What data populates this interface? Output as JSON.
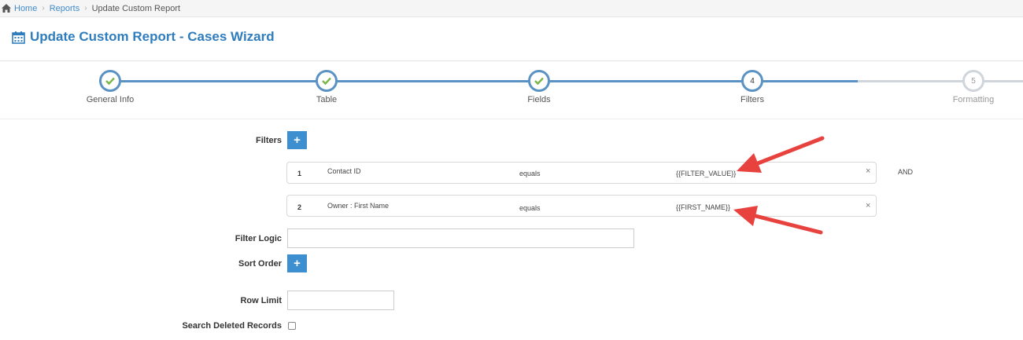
{
  "breadcrumb": {
    "home": "Home",
    "reports": "Reports",
    "current": "Update Custom Report"
  },
  "page": {
    "title": "Update Custom Report - Cases Wizard"
  },
  "wizard": {
    "steps": [
      {
        "label": "General Info",
        "state": "complete",
        "number": ""
      },
      {
        "label": "Table",
        "state": "complete",
        "number": ""
      },
      {
        "label": "Fields",
        "state": "complete",
        "number": ""
      },
      {
        "label": "Filters",
        "state": "active",
        "number": "4"
      },
      {
        "label": "Formatting",
        "state": "pending",
        "number": "5"
      }
    ]
  },
  "form": {
    "filters_label": "Filters",
    "add_symbol": "+",
    "filters": [
      {
        "num": "1",
        "field": "Contact ID",
        "operator": "equals",
        "value": "{{FILTER_VALUE}}",
        "remove": "×"
      },
      {
        "num": "2",
        "field": "Owner : First Name",
        "operator": "equals",
        "value": "{{FIRST_NAME}}",
        "remove": "×"
      }
    ],
    "and_label": "AND",
    "filter_logic_label": "Filter Logic",
    "filter_logic_value": "",
    "sort_order_label": "Sort Order",
    "row_limit_label": "Row Limit",
    "row_limit_value": "",
    "search_deleted_label": "Search Deleted Records",
    "search_deleted_checked": false
  },
  "colors": {
    "accent": "#2f7dbd",
    "button": "#3d8fd0",
    "check": "#7ab648",
    "annotation_arrow": "#e8423f"
  }
}
